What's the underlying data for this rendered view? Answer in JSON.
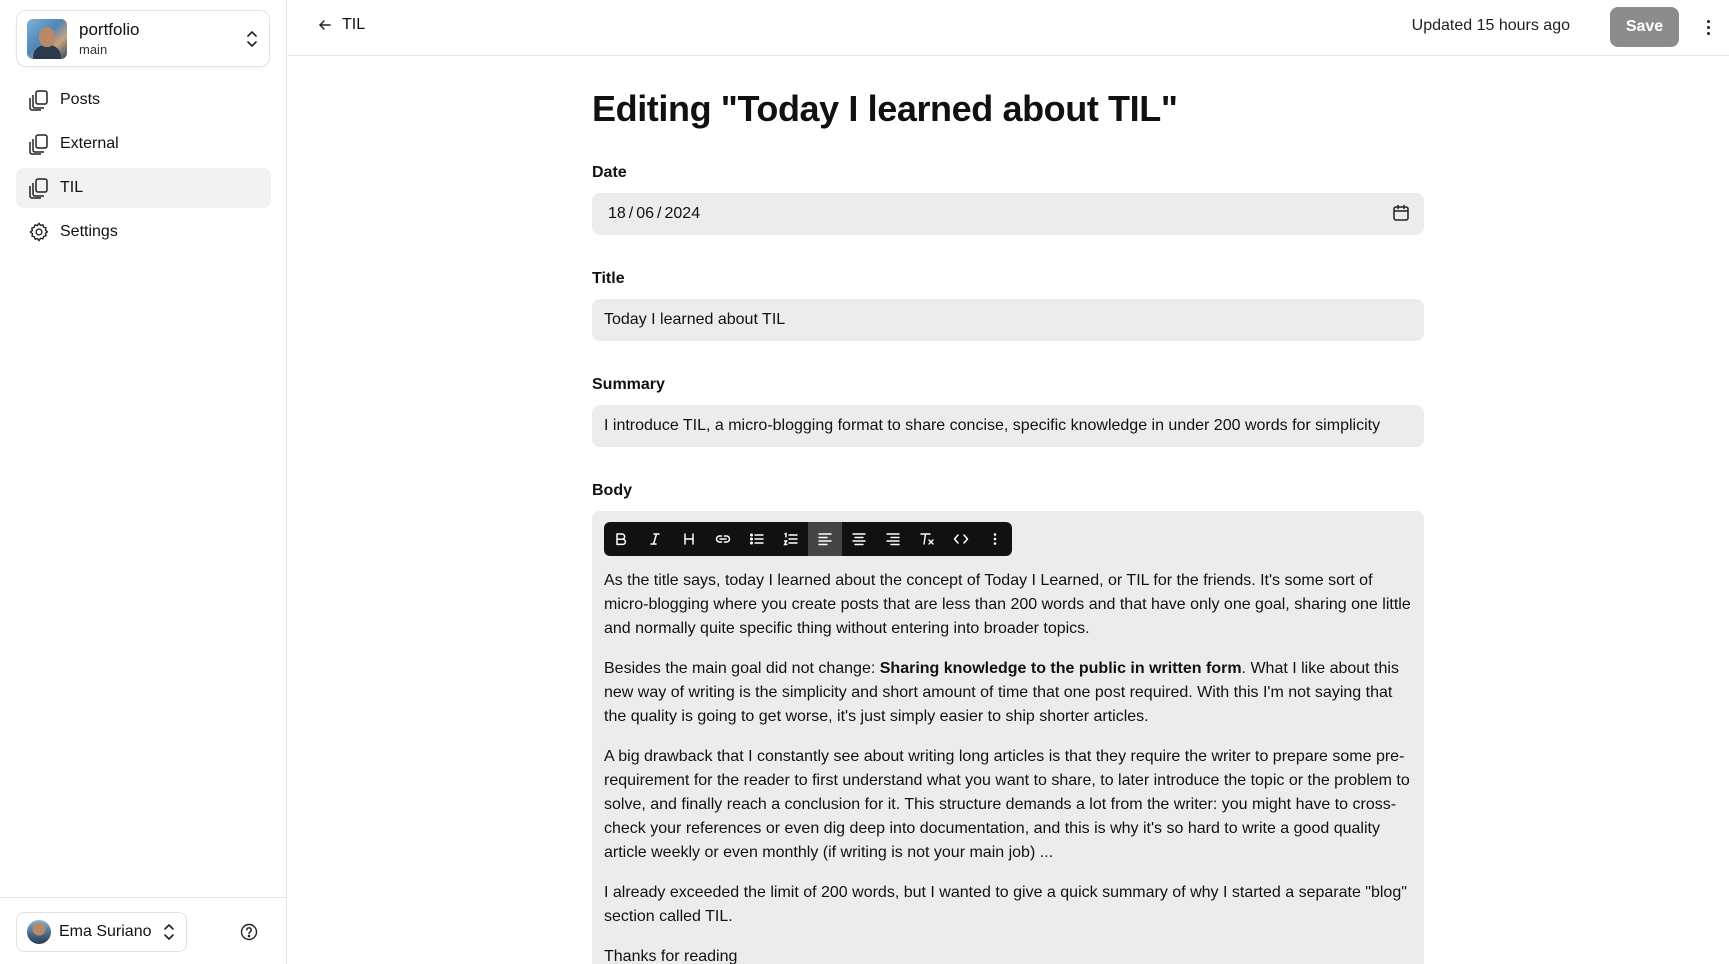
{
  "sidebar": {
    "repo": {
      "name": "portfolio",
      "branch": "main"
    },
    "nav": [
      {
        "label": "Posts",
        "icon": "collection-icon"
      },
      {
        "label": "External",
        "icon": "collection-icon"
      },
      {
        "label": "TIL",
        "icon": "collection-icon",
        "active": true
      },
      {
        "label": "Settings",
        "icon": "gear-icon"
      }
    ],
    "user": {
      "name": "Ema Suriano"
    }
  },
  "topbar": {
    "back_label": "TIL",
    "updated": "Updated 15 hours ago",
    "save_label": "Save"
  },
  "page": {
    "title": "Editing \"Today I learned about TIL\""
  },
  "form": {
    "date": {
      "label": "Date",
      "value_day": "18",
      "value_month": "06",
      "value_year": "2024"
    },
    "title": {
      "label": "Title",
      "value": "Today I learned about TIL"
    },
    "summary": {
      "label": "Summary",
      "value": "I introduce TIL, a micro-blogging format to share concise, specific knowledge in under 200 words for simplicity"
    },
    "body": {
      "label": "Body",
      "toolbar": [
        "bold",
        "italic",
        "heading",
        "link",
        "bullet-list",
        "ordered-list",
        "align-left",
        "align-center",
        "align-right",
        "clear-format",
        "code",
        "more"
      ],
      "active_tool": "align-left",
      "p1": "As the title says, today I learned about the concept of Today I Learned, or TIL for the friends. It's some sort of micro-blogging where you create posts that are less than 200 words and that have only one goal, sharing one little and normally quite specific thing without entering into broader topics.",
      "p2_before": "Besides the main goal did not change: ",
      "p2_bold": "Sharing knowledge to the public in written form",
      "p2_after": ". What I like about this new way of writing is the simplicity and short amount of time that one post required. With this I'm not saying that the quality is going to get worse, it's just simply easier to ship shorter articles.",
      "p3": "A big drawback that I constantly see about writing long articles is that they require the writer to prepare some pre-requirement for the reader to first understand what you want to share, to later introduce the topic or the problem to solve, and finally reach a conclusion for it. This structure demands a lot from the writer: you might have to cross-check your references or even dig deep into documentation, and this is why it's so hard to write a good quality article weekly or even monthly (if writing is not your main job) ...",
      "p4": "I already exceeded the limit of 200 words, but I wanted to give a quick summary of why I started a separate \"blog\" section called TIL.",
      "p5": "Thanks for reading"
    }
  }
}
